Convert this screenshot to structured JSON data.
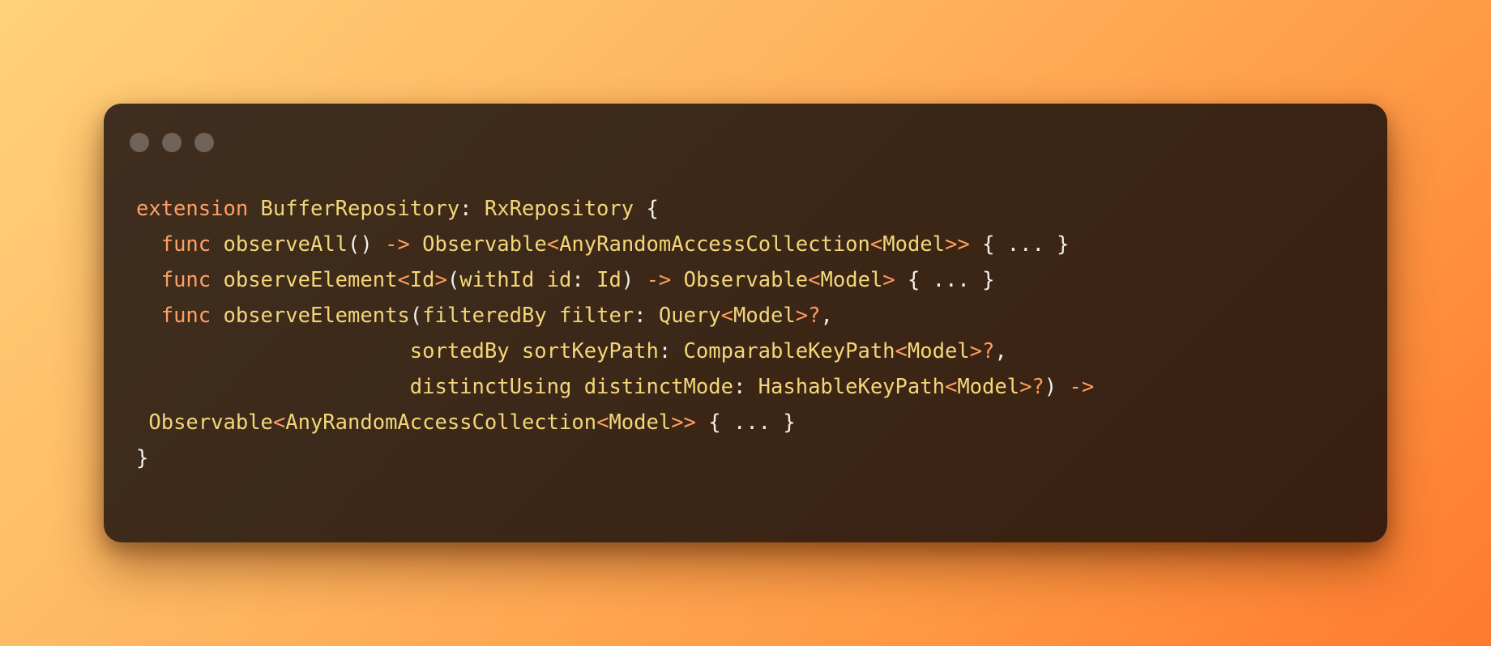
{
  "window": {
    "controls": [
      "close",
      "minimize",
      "zoom"
    ]
  },
  "code": {
    "lines": [
      [
        {
          "t": "extension",
          "c": "kw"
        },
        {
          "t": " ",
          "c": "pu"
        },
        {
          "t": "BufferRepository",
          "c": "ty"
        },
        {
          "t": ": ",
          "c": "pu"
        },
        {
          "t": "RxRepository",
          "c": "ty"
        },
        {
          "t": " {",
          "c": "pu"
        }
      ],
      [
        {
          "t": "  ",
          "c": "pu"
        },
        {
          "t": "func",
          "c": "kw"
        },
        {
          "t": " ",
          "c": "pu"
        },
        {
          "t": "observeAll",
          "c": "ty"
        },
        {
          "t": "() ",
          "c": "pu"
        },
        {
          "t": "->",
          "c": "op"
        },
        {
          "t": " ",
          "c": "pu"
        },
        {
          "t": "Observable",
          "c": "ty"
        },
        {
          "t": "<",
          "c": "op"
        },
        {
          "t": "AnyRandomAccessCollection",
          "c": "ty"
        },
        {
          "t": "<",
          "c": "op"
        },
        {
          "t": "Model",
          "c": "ty"
        },
        {
          "t": ">>",
          "c": "op"
        },
        {
          "t": " { ... }",
          "c": "pu"
        }
      ],
      [
        {
          "t": "  ",
          "c": "pu"
        },
        {
          "t": "func",
          "c": "kw"
        },
        {
          "t": " ",
          "c": "pu"
        },
        {
          "t": "observeElement",
          "c": "ty"
        },
        {
          "t": "<",
          "c": "op"
        },
        {
          "t": "Id",
          "c": "ty"
        },
        {
          "t": ">",
          "c": "op"
        },
        {
          "t": "(",
          "c": "pu"
        },
        {
          "t": "withId id",
          "c": "ty"
        },
        {
          "t": ": ",
          "c": "pu"
        },
        {
          "t": "Id",
          "c": "ty"
        },
        {
          "t": ") ",
          "c": "pu"
        },
        {
          "t": "->",
          "c": "op"
        },
        {
          "t": " ",
          "c": "pu"
        },
        {
          "t": "Observable",
          "c": "ty"
        },
        {
          "t": "<",
          "c": "op"
        },
        {
          "t": "Model",
          "c": "ty"
        },
        {
          "t": ">",
          "c": "op"
        },
        {
          "t": " { ... }",
          "c": "pu"
        }
      ],
      [
        {
          "t": "  ",
          "c": "pu"
        },
        {
          "t": "func",
          "c": "kw"
        },
        {
          "t": " ",
          "c": "pu"
        },
        {
          "t": "observeElements",
          "c": "ty"
        },
        {
          "t": "(",
          "c": "pu"
        },
        {
          "t": "filteredBy filter",
          "c": "ty"
        },
        {
          "t": ": ",
          "c": "pu"
        },
        {
          "t": "Query",
          "c": "ty"
        },
        {
          "t": "<",
          "c": "op"
        },
        {
          "t": "Model",
          "c": "ty"
        },
        {
          "t": ">?",
          "c": "op"
        },
        {
          "t": ",",
          "c": "pu"
        }
      ],
      [
        {
          "t": "                      ",
          "c": "pu"
        },
        {
          "t": "sortedBy sortKeyPath",
          "c": "ty"
        },
        {
          "t": ": ",
          "c": "pu"
        },
        {
          "t": "ComparableKeyPath",
          "c": "ty"
        },
        {
          "t": "<",
          "c": "op"
        },
        {
          "t": "Model",
          "c": "ty"
        },
        {
          "t": ">?",
          "c": "op"
        },
        {
          "t": ",",
          "c": "pu"
        }
      ],
      [
        {
          "t": "                      ",
          "c": "pu"
        },
        {
          "t": "distinctUsing distinctMode",
          "c": "ty"
        },
        {
          "t": ": ",
          "c": "pu"
        },
        {
          "t": "HashableKeyPath",
          "c": "ty"
        },
        {
          "t": "<",
          "c": "op"
        },
        {
          "t": "Model",
          "c": "ty"
        },
        {
          "t": ">?",
          "c": "op"
        },
        {
          "t": ") ",
          "c": "pu"
        },
        {
          "t": "->",
          "c": "op"
        }
      ],
      [
        {
          "t": " ",
          "c": "pu"
        },
        {
          "t": "Observable",
          "c": "ty"
        },
        {
          "t": "<",
          "c": "op"
        },
        {
          "t": "AnyRandomAccessCollection",
          "c": "ty"
        },
        {
          "t": "<",
          "c": "op"
        },
        {
          "t": "Model",
          "c": "ty"
        },
        {
          "t": ">>",
          "c": "op"
        },
        {
          "t": " { ... }",
          "c": "pu"
        }
      ],
      [
        {
          "t": "}",
          "c": "pu"
        }
      ]
    ]
  },
  "colors": {
    "keyword": "#ffa063",
    "type": "#f4d678",
    "operator": "#ff9d5c",
    "punctuation": "#f2f0ea",
    "window_dot": "#6f6258"
  }
}
